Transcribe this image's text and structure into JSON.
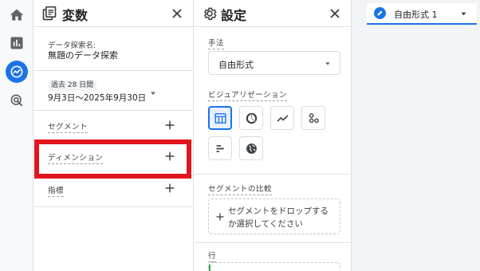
{
  "colors": {
    "accent": "#1a73e8",
    "highlight_box": "#e0151d",
    "text": "#202124",
    "muted": "#5f6368"
  },
  "nav": {
    "icons": [
      "home-icon",
      "reports-icon",
      "explore-icon",
      "advertising-icon"
    ],
    "active": "explore-icon"
  },
  "variables": {
    "title": "変数",
    "explore_name_label": "データ探索名:",
    "explore_name_value": "無題のデータ探索",
    "date_range_badge": "過去 28 日間",
    "date_range_value": "9月3日～2025年9月30日",
    "segments_label": "セグメント",
    "dimensions_label": "ディメンション",
    "metrics_label": "指標"
  },
  "settings": {
    "title": "設定",
    "technique_label": "手法",
    "technique_value": "自由形式",
    "visualization_label": "ビジュアリゼーション",
    "visualizations": [
      "table-icon",
      "donut-chart-icon",
      "line-chart-icon",
      "scatter-chart-icon",
      "bar-chart-icon",
      "geo-map-icon"
    ],
    "active_visualization": "table-icon",
    "segment_compare_label": "セグメントの比較",
    "segment_drop_text_1": "セグメントをドロップする",
    "segment_drop_text_2": "か選択してください",
    "rows_label": "行"
  },
  "canvas": {
    "tab_label": "自由形式 1"
  }
}
